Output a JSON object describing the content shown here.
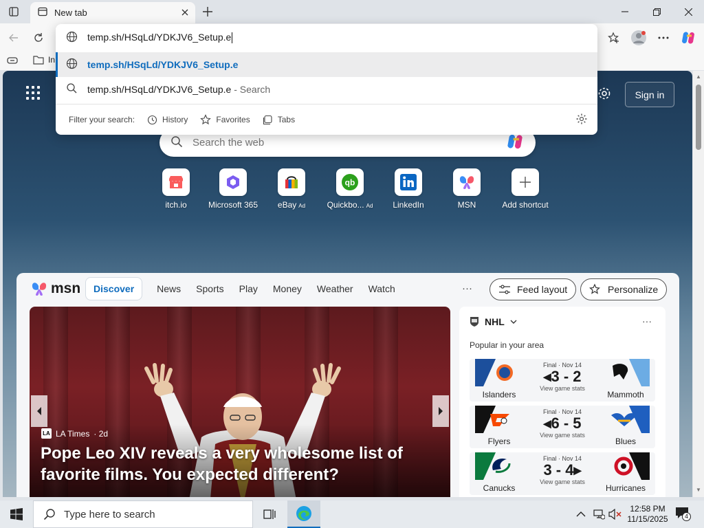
{
  "tab": {
    "title": "New tab"
  },
  "omnibox": {
    "input_value": "temp.sh/HSqLd/YDKJV6_Setup.e",
    "suggestions": [
      {
        "text": "temp.sh/HSqLd/YDKJV6_Setup.e",
        "hint": "",
        "icon": "globe-icon"
      },
      {
        "text": "temp.sh/HSqLd/YDKJV6_Setup.e",
        "hint": "- Search",
        "icon": "search-icon"
      }
    ],
    "filter_label": "Filter your search:",
    "filters": [
      "History",
      "Favorites",
      "Tabs"
    ]
  },
  "favbar": {
    "first_item": "In"
  },
  "ntp": {
    "sign_in": "Sign in",
    "search_placeholder": "Search the web",
    "shortcuts": [
      {
        "name": "itch.io",
        "ad": ""
      },
      {
        "name": "Microsoft 365",
        "ad": ""
      },
      {
        "name": "eBay",
        "ad": "Ad"
      },
      {
        "name": "Quickbo...",
        "ad": "Ad"
      },
      {
        "name": "LinkedIn",
        "ad": ""
      },
      {
        "name": "MSN",
        "ad": ""
      },
      {
        "name": "Add shortcut",
        "ad": ""
      }
    ]
  },
  "msn": {
    "logo": "msn",
    "nav": [
      "Discover",
      "News",
      "Sports",
      "Play",
      "Money",
      "Weather",
      "Watch"
    ],
    "more": "···",
    "feed_layout": "Feed layout",
    "personalize": "Personalize",
    "hero": {
      "source": "LA Times",
      "age": "· 2d",
      "title": "Pope Leo XIV reveals a very wholesome list of favorite films. You expected different?"
    },
    "nhl": {
      "league": "NHL",
      "subtitle": "Popular in your area",
      "games": [
        {
          "status": "Final · Nov 14",
          "home": "Islanders",
          "away": "Mammoth",
          "score": "◂3 - 2",
          "stats": "View game stats",
          "home_color": "#1c4f9c",
          "away_color": "#6cace4"
        },
        {
          "status": "Final · Nov 14",
          "home": "Flyers",
          "away": "Blues",
          "score": "◂6 - 5",
          "stats": "View game stats",
          "home_color": "#111111",
          "away_color": "#1f5fbf"
        },
        {
          "status": "Final · Nov 14",
          "home": "Canucks",
          "away": "Hurricanes",
          "score": "3 - 4▸",
          "stats": "View game stats",
          "home_color": "#0b7a3e",
          "away_color": "#111111"
        }
      ]
    }
  },
  "taskbar": {
    "search_placeholder": "Type here to search",
    "time": "12:58 PM",
    "date": "11/15/2025",
    "notifications": "4"
  }
}
